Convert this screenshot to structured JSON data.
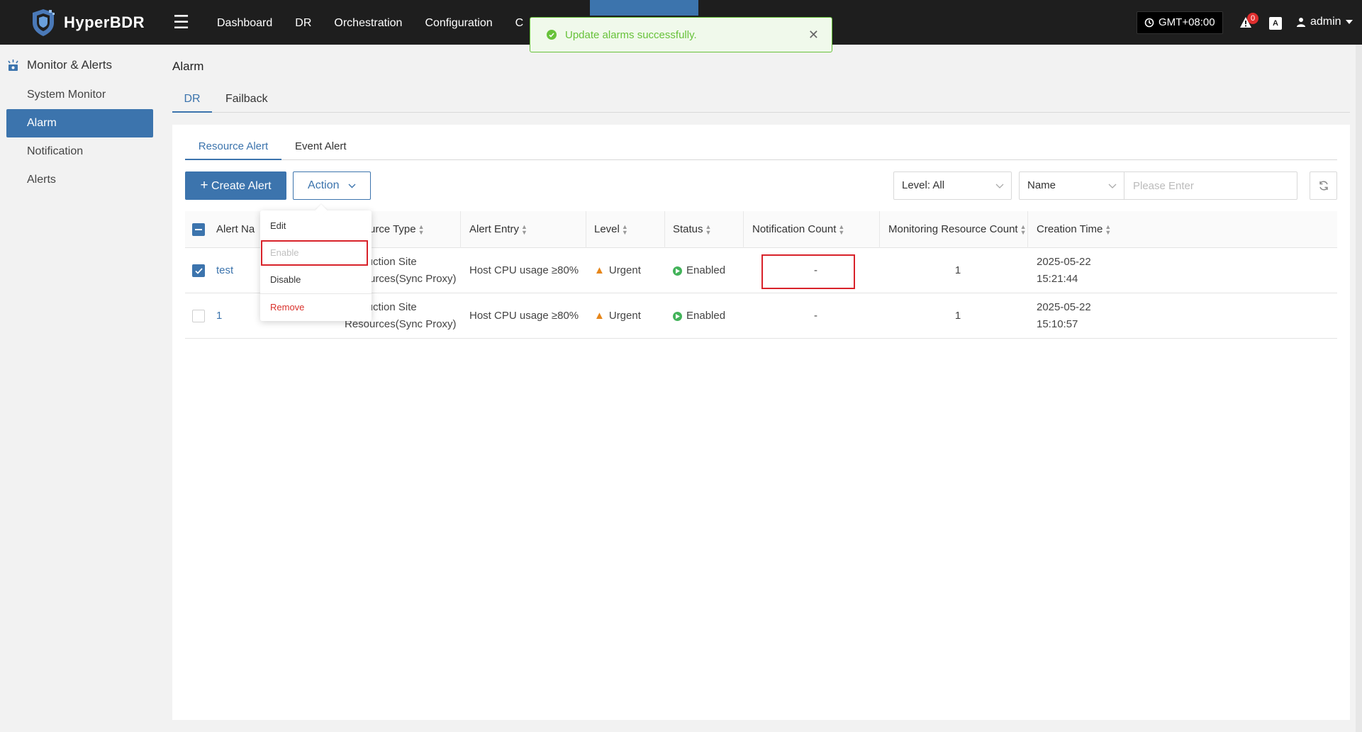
{
  "app": {
    "name": "HyperBDR"
  },
  "topnav": {
    "items": [
      {
        "label": "Dashboard"
      },
      {
        "label": "DR"
      },
      {
        "label": "Orchestration"
      },
      {
        "label": "Configuration"
      },
      {
        "label": "C"
      }
    ],
    "timezone": "GMT+08:00",
    "notification_count": "0",
    "lang_label": "A",
    "user": "admin"
  },
  "sidebar": {
    "title": "Monitor & Alerts",
    "items": [
      {
        "label": "System Monitor"
      },
      {
        "label": "Alarm"
      },
      {
        "label": "Notification"
      },
      {
        "label": "Alerts"
      }
    ]
  },
  "page": {
    "title": "Alarm",
    "tabs": [
      {
        "label": "DR"
      },
      {
        "label": "Failback"
      }
    ],
    "subtabs": [
      {
        "label": "Resource Alert"
      },
      {
        "label": "Event Alert"
      }
    ]
  },
  "toolbar": {
    "create_label": "Create Alert",
    "action_label": "Action",
    "level_filter": "Level: All",
    "search_field": "Name",
    "search_placeholder": "Please Enter"
  },
  "table": {
    "columns": {
      "name": "Alert Na",
      "resource_type": "Resource Type",
      "alert_entry": "Alert Entry",
      "level": "Level",
      "status": "Status",
      "notification_count": "Notification Count",
      "monitoring_resource_count": "Monitoring Resource Count",
      "creation_time": "Creation Time"
    },
    "rows": [
      {
        "checked": true,
        "name": "test",
        "resource_type_1": "Production Site",
        "resource_type_2": "Resources(Sync Proxy)",
        "alert_entry": "Host CPU usage ≥80%",
        "level": "Urgent",
        "status": "Enabled",
        "notification_count": "-",
        "monitoring_resource_count": "1",
        "creation_date": "2025-05-22",
        "creation_time": "15:21:44"
      },
      {
        "checked": false,
        "name": "1",
        "resource_type_1": "Production Site",
        "resource_type_2": "Resources(Sync Proxy)",
        "alert_entry": "Host CPU usage ≥80%",
        "level": "Urgent",
        "status": "Enabled",
        "notification_count": "-",
        "monitoring_resource_count": "1",
        "creation_date": "2025-05-22",
        "creation_time": "15:10:57"
      }
    ]
  },
  "action_menu": {
    "items": [
      {
        "label": "Edit"
      },
      {
        "label": "Enable"
      },
      {
        "label": "Disable"
      },
      {
        "label": "Remove"
      }
    ]
  },
  "toast": {
    "message": "Update alarms successfully."
  },
  "colors": {
    "accent": "#3c74ad",
    "topbar": "#1e1e1e",
    "success": "#67c23a",
    "warning": "#e6861a",
    "danger": "#d9312b",
    "highlight_box": "#d8222a"
  }
}
